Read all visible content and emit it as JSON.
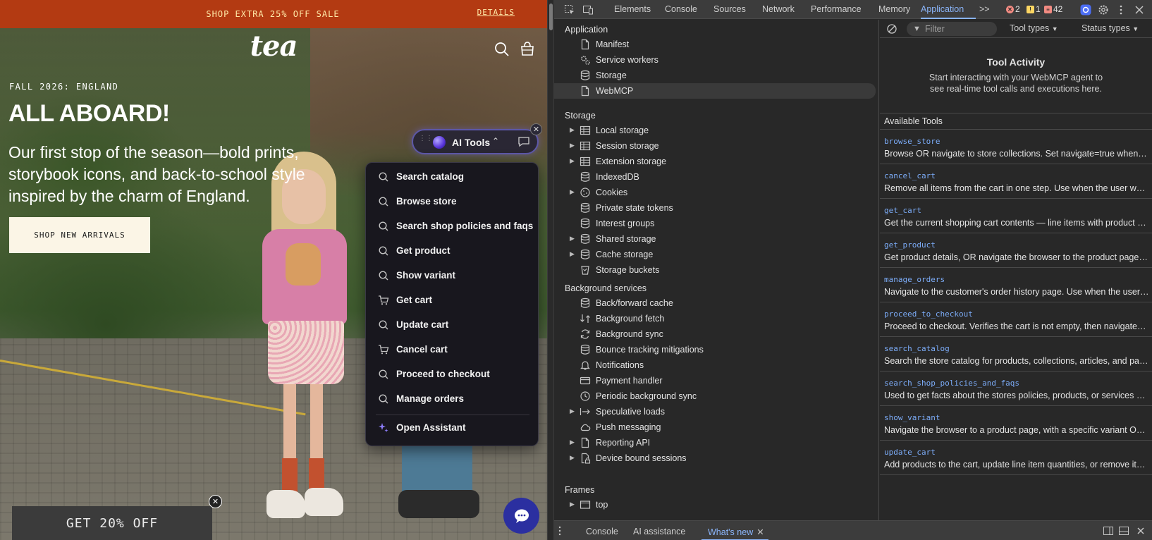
{
  "page": {
    "promo_bar": {
      "text": "SHOP EXTRA 25% OFF SALE",
      "link": "DETAILS"
    },
    "logo": "tea",
    "hero": {
      "season": "FALL 2026: ENGLAND",
      "headline": "ALL ABOARD!",
      "subhead": "Our first stop of the season—bold prints, storybook icons, and back-to-school style inspired by the charm of England.",
      "cta": "SHOP NEW ARRIVALS"
    },
    "ai_tools": {
      "label": "AI Tools",
      "menu": [
        {
          "label": "Search catalog",
          "icon": "search-icon"
        },
        {
          "label": "Browse store",
          "icon": "search-icon"
        },
        {
          "label": "Search shop policies and faqs",
          "icon": "search-icon"
        },
        {
          "label": "Get product",
          "icon": "search-icon"
        },
        {
          "label": "Show variant",
          "icon": "search-icon"
        },
        {
          "label": "Get cart",
          "icon": "cart-icon"
        },
        {
          "label": "Update cart",
          "icon": "search-icon"
        },
        {
          "label": "Cancel cart",
          "icon": "cart-icon"
        },
        {
          "label": "Proceed to checkout",
          "icon": "search-icon"
        },
        {
          "label": "Manage orders",
          "icon": "search-icon"
        }
      ],
      "assistant": "Open Assistant"
    },
    "promo_popup": "GET 20% OFF"
  },
  "devtools": {
    "tabs": [
      "Elements",
      "Console",
      "Sources",
      "Network",
      "Performance",
      "Memory",
      "Application"
    ],
    "active_tab": "Application",
    "more": ">>",
    "issues": {
      "errors": "2",
      "warnings": "1",
      "messages": "42"
    },
    "sidebar": {
      "application_header": "Application",
      "application": [
        "Manifest",
        "Service workers",
        "Storage",
        "WebMCP"
      ],
      "selected": "WebMCP",
      "storage_header": "Storage",
      "storage": [
        "Local storage",
        "Session storage",
        "Extension storage",
        "IndexedDB",
        "Cookies",
        "Private state tokens",
        "Interest groups",
        "Shared storage",
        "Cache storage",
        "Storage buckets"
      ],
      "background_header": "Background services",
      "background": [
        "Back/forward cache",
        "Background fetch",
        "Background sync",
        "Bounce tracking mitigations",
        "Notifications",
        "Payment handler",
        "Periodic background sync",
        "Speculative loads",
        "Push messaging",
        "Reporting API",
        "Device bound sessions"
      ],
      "frames_header": "Frames",
      "frames": [
        "top"
      ]
    },
    "panel": {
      "filter_placeholder": "Filter",
      "tool_types": "Tool types",
      "status_types": "Status types",
      "activity_title": "Tool Activity",
      "activity_desc": "Start interacting with your WebMCP agent to see real-time tool calls and executions here.",
      "available_header": "Available Tools",
      "tools": [
        {
          "name": "browse_store",
          "desc": "Browse OR navigate to store collections. Set navigate=true when the user wants to go to a collection page."
        },
        {
          "name": "cancel_cart",
          "desc": "Remove all items from the cart in one step. Use when the user wants to empty the cart."
        },
        {
          "name": "get_cart",
          "desc": "Get the current shopping cart contents — line items with product details and totals."
        },
        {
          "name": "get_product",
          "desc": "Get product details, OR navigate the browser to the product page when requested."
        },
        {
          "name": "manage_orders",
          "desc": "Navigate to the customer's order history page. Use when the user asks about orders."
        },
        {
          "name": "proceed_to_checkout",
          "desc": "Proceed to checkout. Verifies the cart is not empty, then navigates to the checkout page."
        },
        {
          "name": "search_catalog",
          "desc": "Search the store catalog for products, collections, articles, and pages."
        },
        {
          "name": "search_shop_policies_and_faqs",
          "desc": "Used to get facts about the stores policies, products, or services and answers to FAQs."
        },
        {
          "name": "show_variant",
          "desc": "Navigate the browser to a product page, with a specific variant Optionally selected."
        },
        {
          "name": "update_cart",
          "desc": "Add products to the cart, update line item quantities, or remove items from the cart."
        }
      ]
    },
    "drawer": {
      "tabs": [
        "Console",
        "AI assistance",
        "What's new"
      ],
      "active": "What's new"
    }
  }
}
